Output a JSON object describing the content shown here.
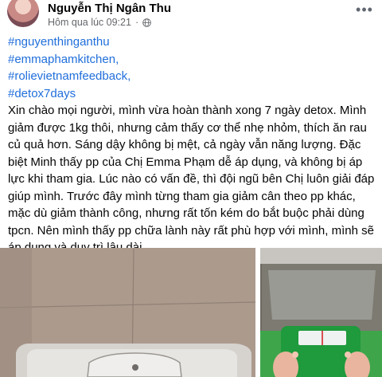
{
  "post": {
    "author": "Nguyễn Thị Ngân Thu",
    "timestamp": "Hôm qua lúc 09:21",
    "separator": "·",
    "more_label": "•••",
    "hashtags": [
      "#nguyenthinganthu",
      "#emmaphamkitchen,",
      "#rolievietnamfeedback,",
      "#detox7days"
    ],
    "text": "Xin chào mọi người, mình vừa hoàn thành xong 7 ngày detox. Mình giảm được 1kg thôi, nhưng cảm thấy cơ thể nhẹ nhỏm, thích ăn rau củ quả hơn. Sáng dậy không bị mệt, cả ngày vẫn năng lượng. Đặc biệt Minh thấy pp của Chị Emma Phạm dễ áp dụng, và không bị áp lực khi tham gia. Lúc nào có vấn đề, thì đội ngũ bên Chị luôn giải đáp giúp mình. Trước đây mình từng tham gia giảm cân theo pp khác, mặc dù giảm thành công, nhưng rất tốn kém do bắt buộc phải dùng tpcn. Nên mình thấy pp chữa lành này rất phù hợp với mình, mình sẽ áp dụng và duy trì lâu dài."
  },
  "icons": {
    "audience": "globe-icon",
    "more": "more-options-icon"
  },
  "colors": {
    "hashtag": "#216fdb",
    "meta": "#65676b",
    "text": "#050505"
  }
}
